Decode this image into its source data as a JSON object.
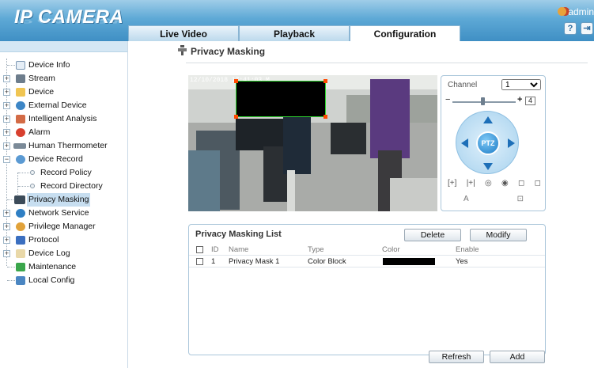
{
  "header": {
    "logo": "IP CAMERA",
    "tabs": [
      {
        "label": "Live Video"
      },
      {
        "label": "Playback"
      },
      {
        "label": "Configuration"
      }
    ],
    "user": "admin",
    "colors": {
      "bar": "#5ea9d6"
    }
  },
  "sidebar": {
    "items": [
      {
        "label": "Device Info",
        "icon": "document-icon"
      },
      {
        "label": "Stream",
        "icon": "film-icon"
      },
      {
        "label": "Device",
        "icon": "folder-icon"
      },
      {
        "label": "External Device",
        "icon": "plug-icon"
      },
      {
        "label": "Intelligent Analysis",
        "icon": "analysis-icon"
      },
      {
        "label": "Alarm",
        "icon": "alarm-icon"
      },
      {
        "label": "Human Thermometer",
        "icon": "thermometer-icon"
      },
      {
        "label": "Device Record",
        "icon": "record-icon"
      },
      {
        "label": "Record Policy",
        "icon": "bullet-icon"
      },
      {
        "label": "Record Directory",
        "icon": "bullet-icon"
      },
      {
        "label": "Privacy Masking",
        "icon": "monitor-icon"
      },
      {
        "label": "Network Service",
        "icon": "globe-icon"
      },
      {
        "label": "Privilege Manager",
        "icon": "users-icon"
      },
      {
        "label": "Protocol",
        "icon": "book-icon"
      },
      {
        "label": "Device Log",
        "icon": "log-icon"
      },
      {
        "label": "Maintenance",
        "icon": "maintenance-icon"
      },
      {
        "label": "Local Config",
        "icon": "config-icon"
      }
    ]
  },
  "main": {
    "title": "Privacy Masking",
    "video": {
      "timestamp": "12/10/2018 17:41:03 M"
    },
    "ptz": {
      "channel_label": "Channel",
      "channel_value": "1",
      "minus": "−",
      "plus": "+",
      "speed": "4",
      "center": "PTZ",
      "tools": [
        "[+]",
        "|+|",
        "◎",
        "◉",
        "◻",
        "◻"
      ],
      "tools2": [
        "A",
        "⊡"
      ]
    },
    "list": {
      "title": "Privacy Masking List",
      "delete_label": "Delete",
      "modify_label": "Modify",
      "columns": [
        "ID",
        "Name",
        "Type",
        "Color",
        "Enable"
      ],
      "rows": [
        {
          "id": "1",
          "name": "Privacy Mask 1",
          "type": "Color Block",
          "color": "#000000",
          "enable": "Yes"
        }
      ]
    },
    "refresh_label": "Refresh",
    "add_label": "Add"
  }
}
